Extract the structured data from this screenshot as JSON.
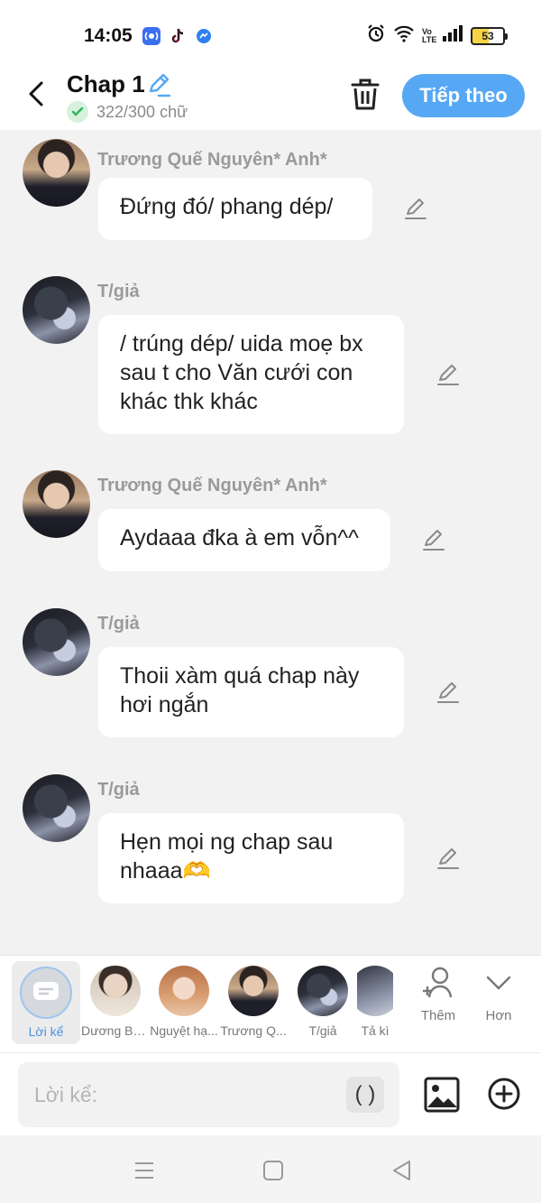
{
  "status": {
    "time": "14:05",
    "battery": "53",
    "network_label": "Vo LTE"
  },
  "header": {
    "title": "Chap 1",
    "word_count": "322/300 chữ",
    "next_label": "Tiếp theo"
  },
  "messages": [
    {
      "sender": "Trương Quế Nguyên* Anh*",
      "text": "Đứng đó/ phang dép/"
    },
    {
      "sender": "T/giả",
      "text": "/ trúng dép/ uida moẹ bx sau t cho Văn cưới con khác thk khác"
    },
    {
      "sender": "Trương Quế Nguyên* Anh*",
      "text": "Aydaaa đka à em vỗn^^"
    },
    {
      "sender": "T/giả",
      "text": "Thoii xàm quá chap này hơi ngắn"
    },
    {
      "sender": "T/giả",
      "text": "Hẹn mọi ng chap sau nhaaa🫶"
    }
  ],
  "characters": [
    {
      "name": "Lời kể",
      "selected": true
    },
    {
      "name": "Dương Bá..."
    },
    {
      "name": "Nguyệt hạ..."
    },
    {
      "name": "Trương Q..."
    },
    {
      "name": "T/giả"
    },
    {
      "name": "Tả kì"
    }
  ],
  "actions": {
    "add_label": "Thêm",
    "more_label": "Hơn"
  },
  "input": {
    "placeholder": "Lời kể:",
    "paren_label": "( )"
  },
  "colors": {
    "accent": "#56a8f5",
    "selected_label": "#4a92e0",
    "check_green": "#2fb45a",
    "background": "#f2f2f2"
  }
}
